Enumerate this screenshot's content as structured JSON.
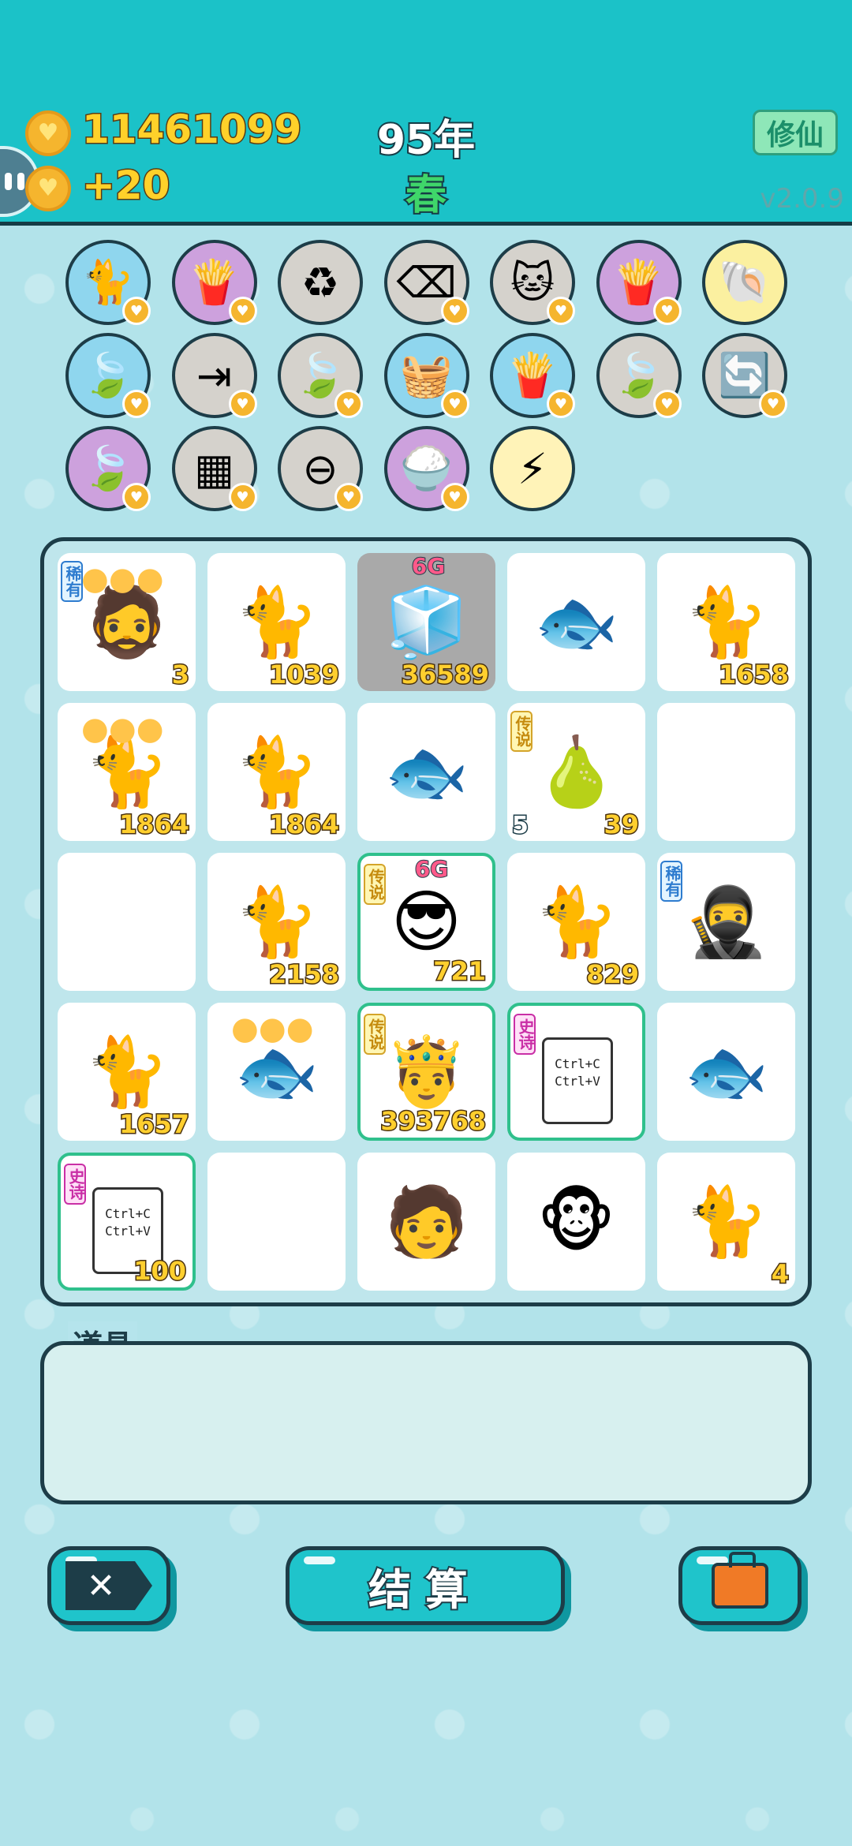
{
  "header": {
    "money": "11461099",
    "income": "+20",
    "year": "95年",
    "season": "春",
    "mode_button": "修仙",
    "version": "v2.0.9"
  },
  "skills": [
    {
      "icon": "cat-icon",
      "glyph": "🐈",
      "color": "blue",
      "badge": true
    },
    {
      "icon": "fries-icon",
      "glyph": "🍟",
      "color": "purple",
      "badge": true
    },
    {
      "icon": "recycle-icon",
      "glyph": "♻",
      "color": "gray",
      "badge": false
    },
    {
      "icon": "delete-tag-icon",
      "glyph": "⌫",
      "color": "gray",
      "badge": true
    },
    {
      "icon": "twin-cats-icon",
      "glyph": "🐱",
      "color": "gray",
      "badge": true
    },
    {
      "icon": "fries-icon",
      "glyph": "🍟",
      "color": "purple",
      "badge": true
    },
    {
      "icon": "shell-icon",
      "glyph": "🐚",
      "color": "yellow",
      "badge": false
    },
    {
      "icon": "leaf-icon",
      "glyph": "🍃",
      "color": "blue",
      "badge": true
    },
    {
      "icon": "skip-icon",
      "glyph": "⇥",
      "color": "gray",
      "badge": true
    },
    {
      "icon": "leaf-icon",
      "glyph": "🍃",
      "color": "gray",
      "badge": true
    },
    {
      "icon": "fruit-basket-icon",
      "glyph": "🧺",
      "color": "blue",
      "badge": true
    },
    {
      "icon": "fries-icon",
      "glyph": "🍟",
      "color": "blue",
      "badge": true
    },
    {
      "icon": "leaf-icon",
      "glyph": "🍃",
      "color": "gray",
      "badge": true
    },
    {
      "icon": "refresh-icon",
      "glyph": "🔄",
      "color": "gray",
      "badge": true
    },
    {
      "icon": "leaf-icon",
      "glyph": "🍃",
      "color": "purple",
      "badge": true
    },
    {
      "icon": "sugar-cubes-icon",
      "glyph": "▦",
      "color": "gray",
      "badge": true
    },
    {
      "icon": "minus-circle-icon",
      "glyph": "⊖",
      "color": "gray",
      "badge": true
    },
    {
      "icon": "rice-bowl-icon",
      "glyph": "🍚",
      "color": "purple",
      "badge": true
    },
    {
      "icon": "lightning-icon",
      "glyph": "⚡",
      "color": "gold",
      "badge": false
    }
  ],
  "board": [
    {
      "name": "rare-thug",
      "glyph": "🧔",
      "num": "3",
      "tag": "稀有",
      "tagClass": "rare",
      "coins": true
    },
    {
      "name": "cat-black-face",
      "glyph": "🐈",
      "num": "1039"
    },
    {
      "name": "fridge",
      "glyph": "🧊",
      "num": "36589",
      "gray": true,
      "gtag": "6G"
    },
    {
      "name": "fish",
      "glyph": "🐟",
      "num": ""
    },
    {
      "name": "cat",
      "glyph": "🐈",
      "num": "1658"
    },
    {
      "name": "cat-coins",
      "glyph": "🐈",
      "num": "1864",
      "coins": true
    },
    {
      "name": "cat",
      "glyph": "🐈",
      "num": "1864"
    },
    {
      "name": "fish",
      "glyph": "🐟",
      "num": ""
    },
    {
      "name": "legend-pear",
      "glyph": "🍐",
      "num": "39",
      "lnum": "5",
      "tag": "传说",
      "tagClass": "legend"
    },
    {
      "name": "empty",
      "glyph": "",
      "num": ""
    },
    {
      "name": "empty",
      "glyph": "",
      "num": ""
    },
    {
      "name": "cat",
      "glyph": "🐈",
      "num": "2158"
    },
    {
      "name": "legend-sunglasses-man",
      "glyph": "😎",
      "num": "721",
      "tag": "传说",
      "tagClass": "legend",
      "gtag": "6G",
      "glow": true
    },
    {
      "name": "cat",
      "glyph": "🐈",
      "num": "829"
    },
    {
      "name": "rare-thief",
      "glyph": "🥷",
      "num": "",
      "tag": "稀有",
      "tagClass": "rare"
    },
    {
      "name": "cat-coin",
      "glyph": "🐈",
      "num": "1657"
    },
    {
      "name": "fish-coins",
      "glyph": "🐟",
      "num": "",
      "coins": true
    },
    {
      "name": "legend-gold-king",
      "glyph": "🤴",
      "num": "393768",
      "tag": "传说",
      "tagClass": "legend",
      "glow": true
    },
    {
      "name": "epic-copy-paste",
      "glyph": "",
      "num": "",
      "tag": "史诗",
      "tagClass": "epic",
      "copy": true,
      "glow": true
    },
    {
      "name": "fish",
      "glyph": "🐟",
      "num": ""
    },
    {
      "name": "epic-copy-paste",
      "glyph": "",
      "num": "100",
      "tag": "史诗",
      "tagClass": "epic",
      "copy": true,
      "glow": true
    },
    {
      "name": "empty",
      "glyph": "",
      "num": ""
    },
    {
      "name": "bucket-hat-man",
      "glyph": "🧑",
      "num": ""
    },
    {
      "name": "monkey",
      "glyph": "🐵",
      "num": ""
    },
    {
      "name": "cat",
      "glyph": "🐈",
      "num": "4"
    }
  ],
  "copy_text": {
    "line1": "Ctrl+C",
    "line2": "Ctrl+V"
  },
  "props": {
    "label": "道具"
  },
  "buttons": {
    "settle": "结算"
  }
}
